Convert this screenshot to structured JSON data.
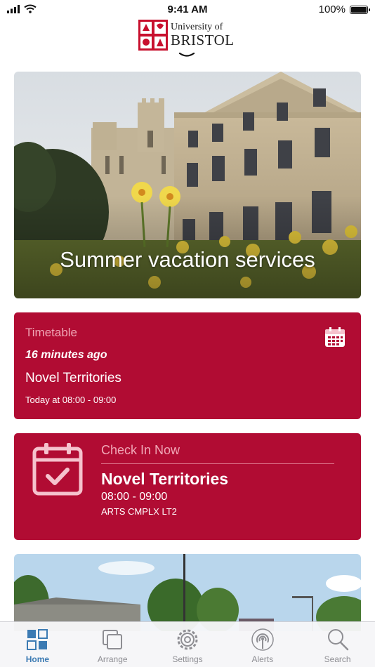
{
  "status_bar": {
    "time": "9:41 AM",
    "battery_text": "100%",
    "battery_level": 1.0
  },
  "header": {
    "logo_line1": "University of",
    "logo_line2": "BRISTOL"
  },
  "hero": {
    "title": "Summer vacation services"
  },
  "timetable_card": {
    "label": "Timetable",
    "ago": "16 minutes ago",
    "event": "Novel Territories",
    "time": "Today at 08:00 - 09:00",
    "icon": "calendar-icon"
  },
  "checkin_card": {
    "label": "Check In Now",
    "event": "Novel Territories",
    "time": "08:00 - 09:00",
    "room": "ARTS CMPLX LT2",
    "icon": "calendar-check-icon"
  },
  "tabs": [
    {
      "label": "Home",
      "icon": "grid-icon",
      "active": true
    },
    {
      "label": "Arrange",
      "icon": "layers-icon",
      "active": false
    },
    {
      "label": "Settings",
      "icon": "gear-icon",
      "active": false
    },
    {
      "label": "Alerts",
      "icon": "broadcast-icon",
      "active": false
    },
    {
      "label": "Search",
      "icon": "search-icon",
      "active": false
    }
  ],
  "colors": {
    "brand_red": "#b10c33",
    "active_tab": "#3c7bb3",
    "inactive_tab": "#8e8e93"
  }
}
